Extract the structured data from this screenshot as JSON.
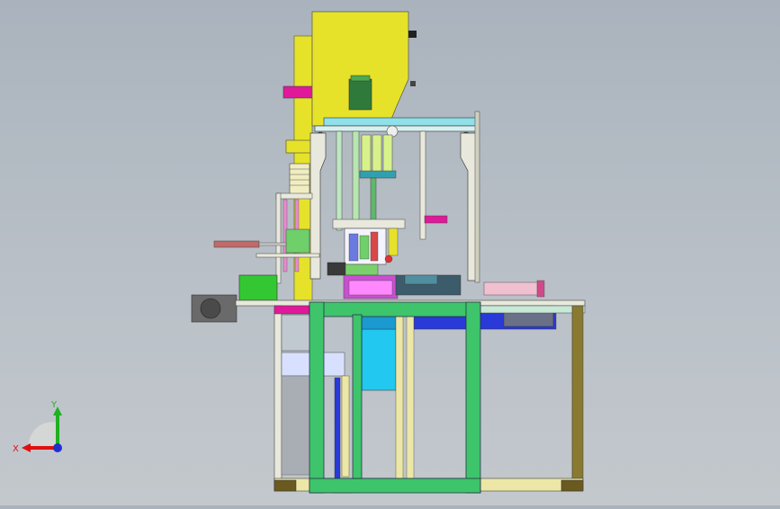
{
  "viewport": {
    "background_top": "#aab3bd",
    "background_bottom": "#c3c8cd",
    "model": "machine-assembly-3d-model"
  },
  "triad": {
    "x_label": "X",
    "y_label": "Y",
    "x_color": "#e01010",
    "y_color": "#20b020",
    "z_color": "#2030d0"
  },
  "colors": {
    "yellow": "#e6e22a",
    "green": "#3ec46a",
    "magenta": "#e0189a",
    "cyan": "#22c8f0",
    "blue": "#2a3ad8",
    "olive": "#8a7a30",
    "cream": "#ece7a6",
    "gray": "#9aa0a6"
  }
}
